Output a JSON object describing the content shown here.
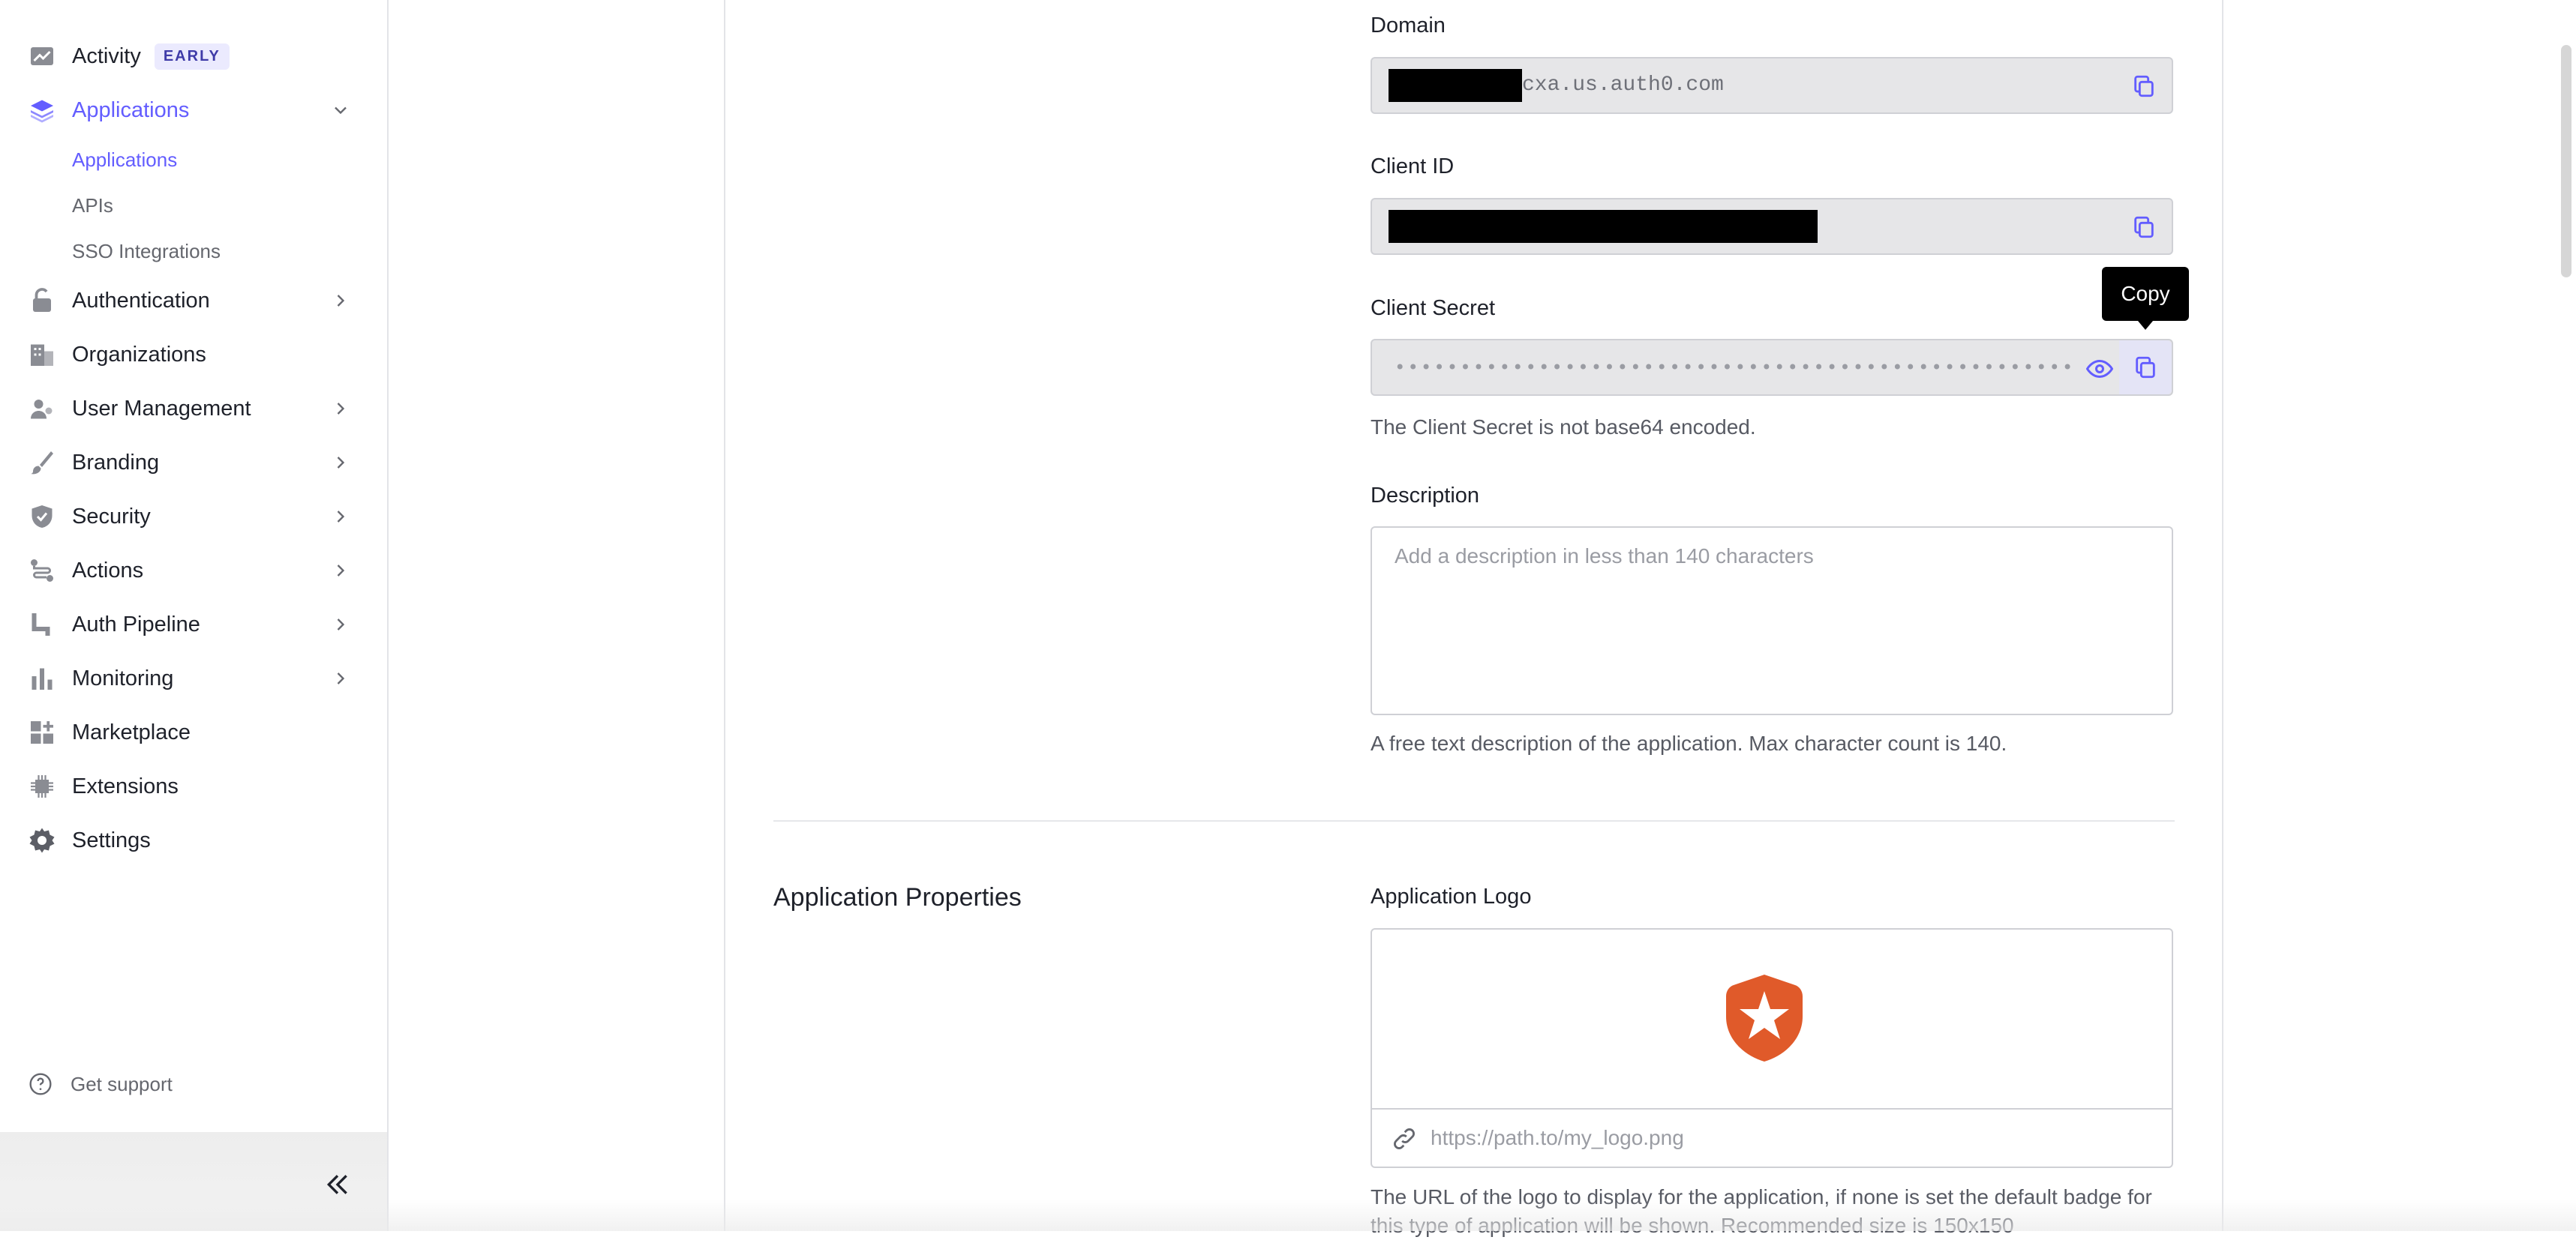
{
  "sidebar": {
    "items": [
      {
        "label": "Activity",
        "icon": "activity-chart-icon",
        "badge": "EARLY"
      },
      {
        "label": "Applications",
        "icon": "layers-icon",
        "active": true
      },
      {
        "label": "Authentication",
        "icon": "lock-icon"
      },
      {
        "label": "Organizations",
        "icon": "building-icon"
      },
      {
        "label": "User Management",
        "icon": "users-icon"
      },
      {
        "label": "Branding",
        "icon": "brush-icon"
      },
      {
        "label": "Security",
        "icon": "shield-icon"
      },
      {
        "label": "Actions",
        "icon": "flow-icon"
      },
      {
        "label": "Auth Pipeline",
        "icon": "pipeline-icon"
      },
      {
        "label": "Monitoring",
        "icon": "bar-chart-icon"
      },
      {
        "label": "Marketplace",
        "icon": "grid-plus-icon"
      },
      {
        "label": "Extensions",
        "icon": "chip-icon"
      },
      {
        "label": "Settings",
        "icon": "gear-icon"
      }
    ],
    "sub_items": [
      {
        "label": "Applications",
        "active": true
      },
      {
        "label": "APIs"
      },
      {
        "label": "SSO Integrations"
      }
    ],
    "support_label": "Get support"
  },
  "form": {
    "domain_label": "Domain",
    "domain_value": "cxa.us.auth0.com",
    "client_id_label": "Client ID",
    "client_secret_label": "Client Secret",
    "client_secret_masked": "••••••••••••••••••••••••••••••••••••••••••••••••••••",
    "client_secret_help": "The Client Secret is not base64 encoded.",
    "tooltip": "Copy",
    "description_label": "Description",
    "description_placeholder": "Add a description in less than 140 characters",
    "description_help": "A free text description of the application. Max character count is 140."
  },
  "properties": {
    "section_title": "Application Properties",
    "logo_label": "Application Logo",
    "logo_url_placeholder": "https://path.to/my_logo.png",
    "logo_help": "The URL of the logo to display for the application, if none is set the default badge for this type of application will be shown. Recommended size is 150x150"
  },
  "colors": {
    "accent": "#635dff",
    "logo": "#e05a2a"
  }
}
